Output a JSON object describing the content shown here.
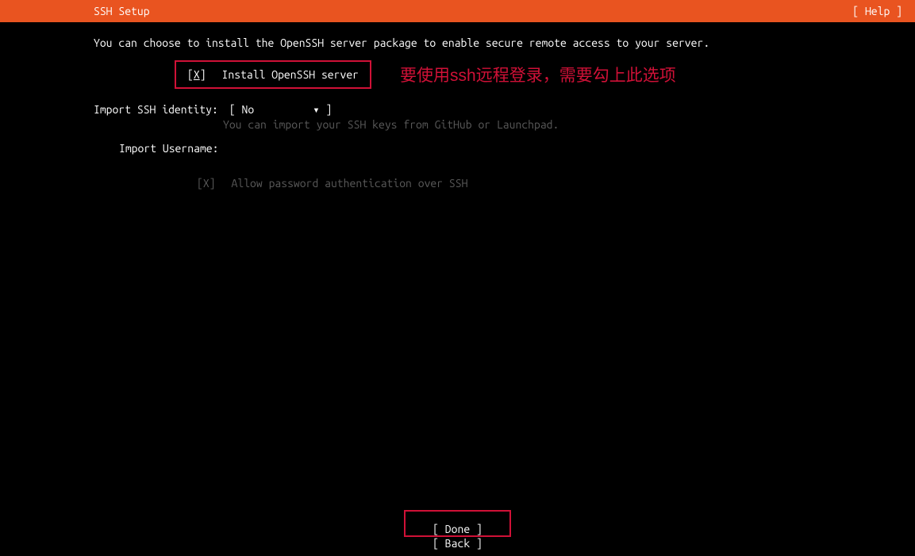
{
  "header": {
    "title": "SSH Setup",
    "help": "[ Help ]"
  },
  "description": "You can choose to install the OpenSSH server package to enable secure remote access to your server.",
  "install": {
    "checkbox_open": "[",
    "checkbox_mark": "X",
    "checkbox_close": "]",
    "label": "Install OpenSSH server"
  },
  "annotation": "要使用ssh远程登录，需要勾上此选项",
  "import_identity": {
    "label": "Import SSH identity:",
    "value_open": "[ ",
    "value": "No",
    "dropdown": "▾",
    "value_close": " ]",
    "help": "You can import your SSH keys from GitHub or Launchpad."
  },
  "import_username": {
    "label": "Import Username:"
  },
  "allow_password": {
    "checkbox": "[X]",
    "label": "Allow password authentication over SSH"
  },
  "buttons": {
    "done": "[ Done       ]",
    "back": "[ Back       ]"
  }
}
